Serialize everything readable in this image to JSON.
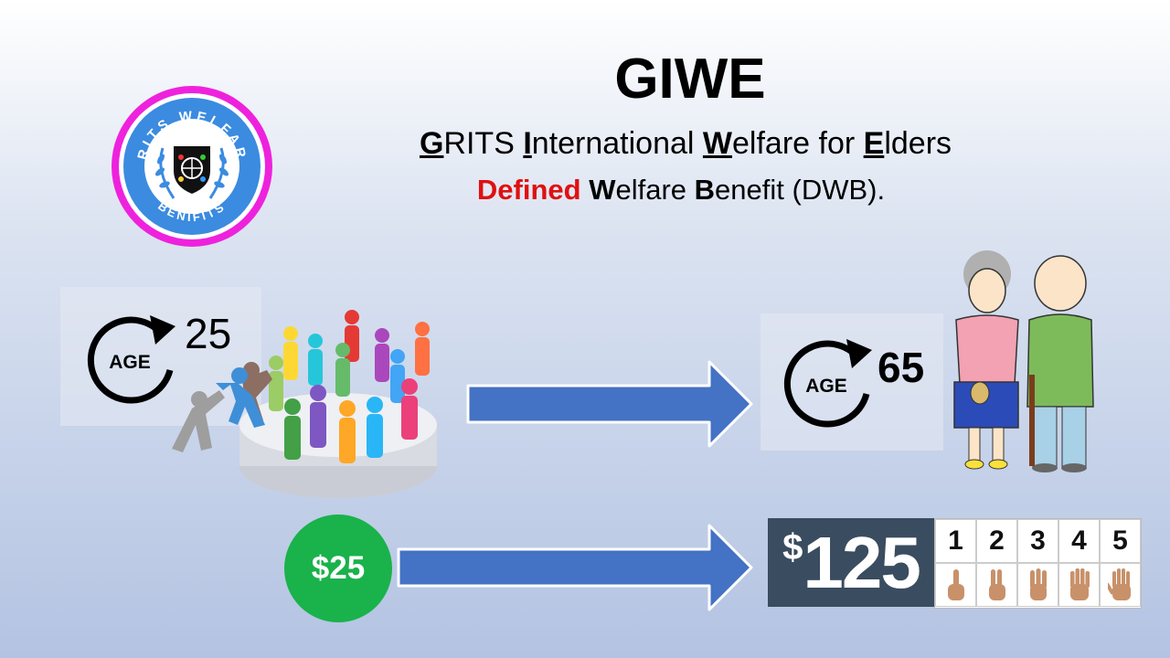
{
  "logo": {
    "top_text": "GRITS  WELFARE",
    "bottom_text": "BENIFITS"
  },
  "title": "GIWE",
  "subtitle1": [
    {
      "t": "G",
      "s": "hl"
    },
    {
      "t": "RITS ",
      "s": ""
    },
    {
      "t": "I",
      "s": "hl"
    },
    {
      "t": "nternational ",
      "s": ""
    },
    {
      "t": "W",
      "s": "hl"
    },
    {
      "t": "elfare for ",
      "s": ""
    },
    {
      "t": "E",
      "s": "hl"
    },
    {
      "t": "lders",
      "s": ""
    }
  ],
  "subtitle2": [
    {
      "t": "Defined",
      "s": "red"
    },
    {
      "t": " ",
      "s": ""
    },
    {
      "t": "W",
      "s": "b"
    },
    {
      "t": "elfare  ",
      "s": ""
    },
    {
      "t": "B",
      "s": "b"
    },
    {
      "t": "enefit (DWB).",
      "s": ""
    }
  ],
  "age_start": {
    "label": "AGE",
    "value": "25"
  },
  "age_end": {
    "label": "AGE",
    "value": "65"
  },
  "contribution": "$25",
  "payout": {
    "currency": "$",
    "amount": "125"
  },
  "counting": [
    "1",
    "2",
    "3",
    "4",
    "5"
  ],
  "colors": {
    "arrow": "#4472c4",
    "coin": "#1ab24a",
    "money_bg": "#3a4c5f",
    "logo_ring": "#ee22dd",
    "logo_blue": "#3b8be0"
  }
}
